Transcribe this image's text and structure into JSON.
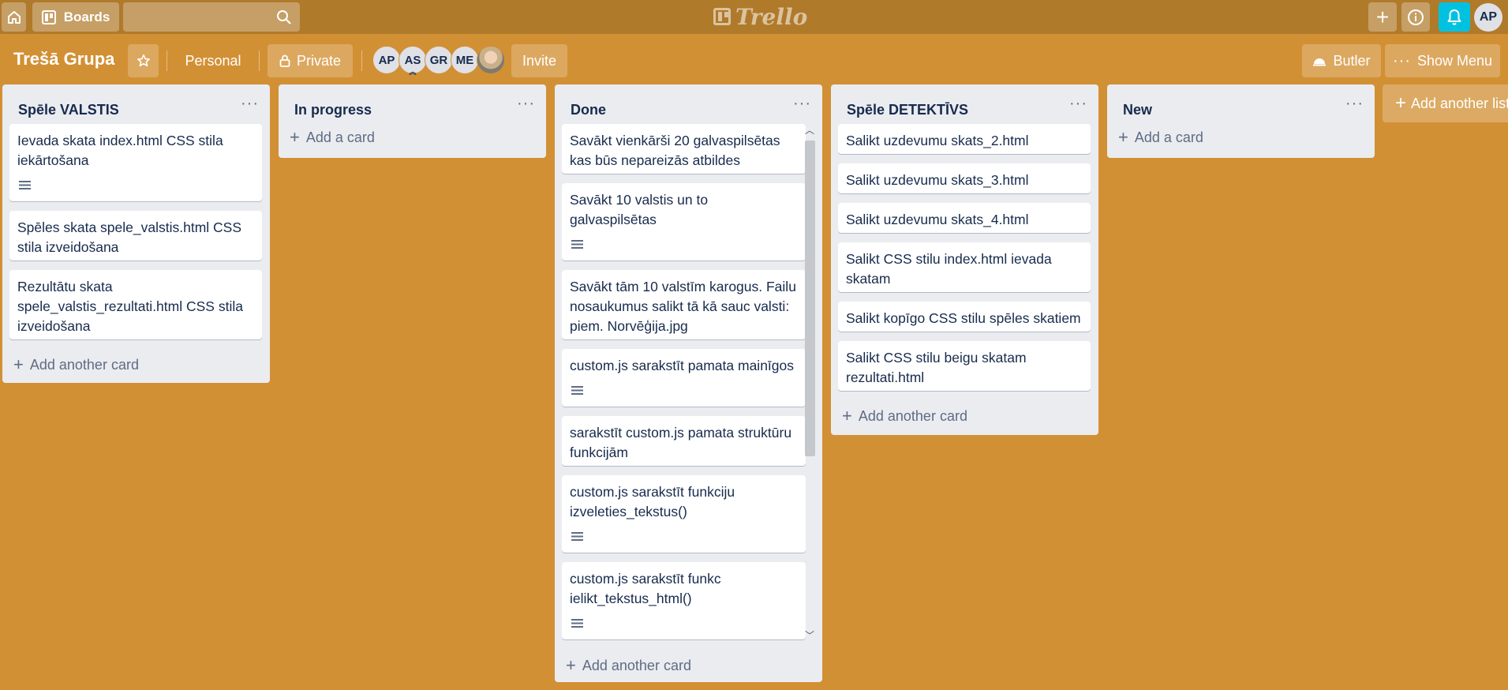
{
  "header": {
    "boards_label": "Boards",
    "search_placeholder": "",
    "logo_text": "Trello",
    "user_initials": "AP"
  },
  "board": {
    "title": "Trešā Grupa",
    "team_label": "Personal",
    "visibility_label": "Private",
    "members": [
      "AP",
      "AS",
      "GR",
      "ME"
    ],
    "invite_label": "Invite",
    "butler_label": "Butler",
    "menu_label": "Show Menu"
  },
  "lists": [
    {
      "title": "Spēle VALSTIS",
      "cards": [
        "Ievada skata index.html CSS stila iekārtošana",
        "Spēles skata spele_valstis.html CSS stila izveidošana",
        "Rezultātu skata spele_valstis_rezultati.html CSS stila izveidošana"
      ],
      "add_label": "Add another card"
    },
    {
      "title": "In progress",
      "cards": [],
      "add_label": "Add a card"
    },
    {
      "title": "Done",
      "cards": [
        "Savākt vienkārši 20 galvaspilsētas kas būs nepareizās atbildes",
        "Savākt 10 valstis un to galvaspilsētas",
        "Savākt tām 10 valstīm karogus. Failu nosaukumus salikt tā kā sauc valsti: piem. Norvēģija.jpg",
        "custom.js sarakstīt pamata mainīgos",
        "sarakstīt custom.js pamata struktūru funkcijām",
        "custom.js sarakstīt funkciju izveleties_tekstus()",
        "custom.js sarakstīt funkc ielikt_tekstus_html()"
      ],
      "add_label": "Add another card"
    },
    {
      "title": "Spēle DETEKTĪVS",
      "cards": [
        "Salikt uzdevumu skats_2.html",
        "Salikt uzdevumu skats_3.html",
        "Salikt uzdevumu skats_4.html",
        "Salikt CSS stilu index.html ievada skatam",
        "Salikt kopīgo CSS stilu spēles skatiem",
        "Salikt CSS stilu beigu skatam rezultati.html"
      ],
      "add_label": "Add another card"
    },
    {
      "title": "New",
      "cards": [],
      "add_label": "Add a card"
    }
  ],
  "add_list_label": "Add another list",
  "colors": {
    "board_bg": "#d29034",
    "header_bg": "#b07a2b",
    "notification_accent": "#00c2e0"
  }
}
